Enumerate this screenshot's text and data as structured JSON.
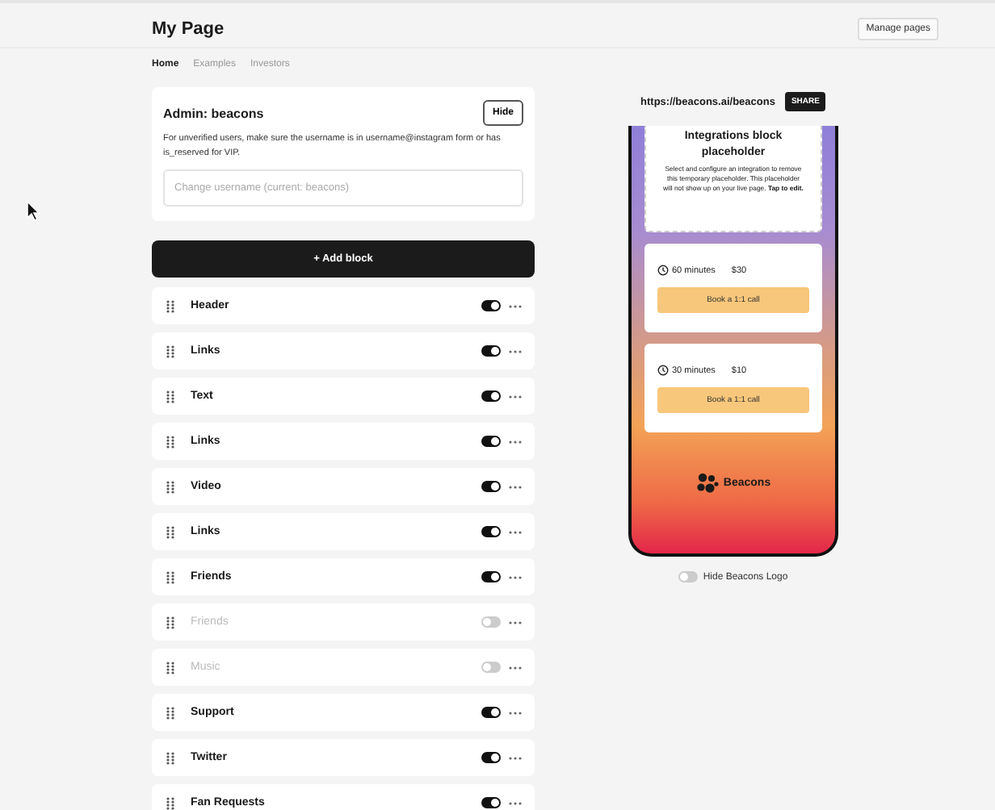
{
  "header": {
    "title": "My Page",
    "manage_button": "Manage pages"
  },
  "tabs": [
    {
      "label": "Home",
      "selected": true
    },
    {
      "label": "Examples",
      "selected": false
    },
    {
      "label": "Investors",
      "selected": false
    }
  ],
  "admin": {
    "title": "Admin: beacons",
    "hide_button": "Hide",
    "note": "For unverified users, make sure the username is in username@instagram form or has is_reserved for VIP.",
    "placeholder": "Change username (current: beacons)"
  },
  "add_block": "+ Add block",
  "blocks": [
    {
      "label": "Header",
      "on": true
    },
    {
      "label": "Links",
      "on": true
    },
    {
      "label": "Text",
      "on": true
    },
    {
      "label": "Links",
      "on": true
    },
    {
      "label": "Video",
      "on": true
    },
    {
      "label": "Links",
      "on": true
    },
    {
      "label": "Friends",
      "on": true
    },
    {
      "label": "Friends",
      "on": false
    },
    {
      "label": "Music",
      "on": false
    },
    {
      "label": "Support",
      "on": true
    },
    {
      "label": "Twitter",
      "on": true
    },
    {
      "label": "Fan Requests",
      "on": true
    }
  ],
  "preview": {
    "url": "https://beacons.ai/beacons",
    "share": "SHARE",
    "placeholder_title": "Integrations block placeholder",
    "placeholder_text": "Select and configure an integration to remove this temporary placeholder. This placeholder will not show up on your live page. **Tap to edit.**",
    "bookings": [
      {
        "duration": "60 minutes",
        "price": "$30",
        "button": "Book a 1:1 call"
      },
      {
        "duration": "30 minutes",
        "price": "$10",
        "button": "Book a 1:1 call"
      }
    ],
    "logo": "Beacons"
  },
  "hide_logo": {
    "label": "Hide Beacons Logo",
    "on": false
  }
}
